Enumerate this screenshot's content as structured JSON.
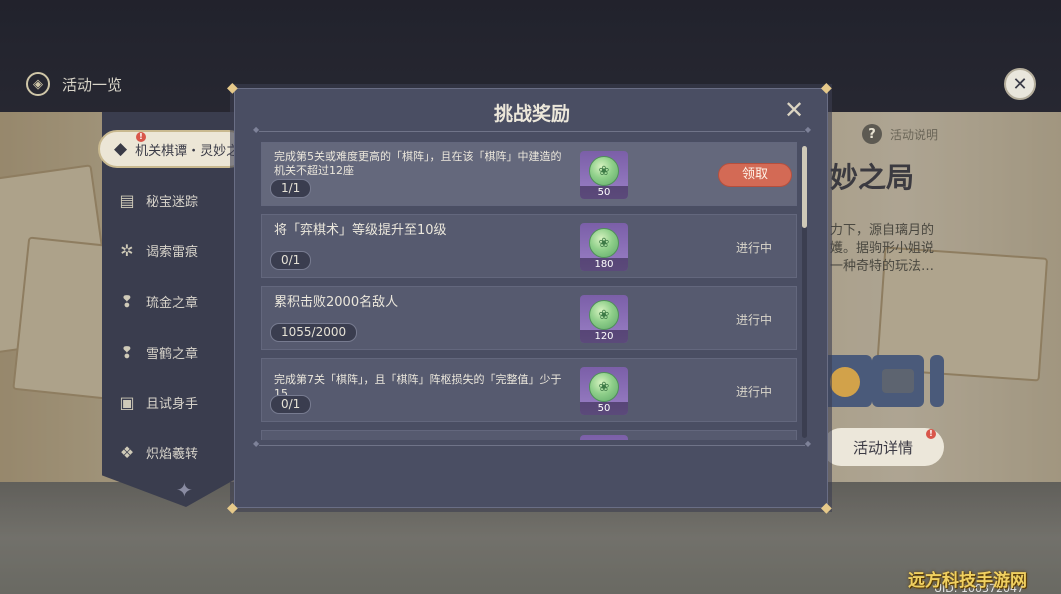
{
  "header": {
    "title": "活动一览",
    "close_label": "✕"
  },
  "sidebar": {
    "active": {
      "label": "机关棋谭・灵妙之局",
      "icon": "chess-icon",
      "badge": "!"
    },
    "items": [
      {
        "label": "秘宝迷踪",
        "icon": "treasure-chest-icon"
      },
      {
        "label": "谒索雷痕",
        "icon": "electro-swirl-icon"
      },
      {
        "label": "琉金之章",
        "icon": "exclamation-crest-icon"
      },
      {
        "label": "雪鹤之章",
        "icon": "exclamation-crest-icon"
      },
      {
        "label": "且试身手",
        "icon": "cards-icon"
      },
      {
        "label": "炽焰羲转",
        "icon": "flame-swirl-icon"
      }
    ]
  },
  "event_panel": {
    "help_label": "活动说明",
    "title_fragment": "妙之局",
    "desc_lines": [
      "力下，源自璃月的",
      "嬳。据驹形小姐说",
      "一种奇特的玩法…"
    ],
    "details_button": "活动详情",
    "details_badge": "!"
  },
  "modal": {
    "title": "挑战奖励",
    "close_label": "✕",
    "rewards": [
      {
        "text": "完成第5关或难度更高的「棋阵」，且在该「棋阵」中建造的机关不超过12座",
        "progress": "1/1",
        "item_count": "50",
        "action": "领取",
        "claimable": true
      },
      {
        "text": "将「弈棋术」等级提升至10级",
        "progress": "0/1",
        "item_count": "180",
        "action": "进行中",
        "claimable": false
      },
      {
        "text": "累积击败2000名敌人",
        "progress": "1055/2000",
        "item_count": "120",
        "action": "进行中",
        "claimable": false
      },
      {
        "text": "完成第7关「棋阵」，且「棋阵」阵枢损失的「完整值」少于15",
        "progress": "0/1",
        "item_count": "50",
        "action": "进行中",
        "claimable": false
      }
    ]
  },
  "uid_text": "UID: 100372047",
  "watermark": "远方科技手游网"
}
